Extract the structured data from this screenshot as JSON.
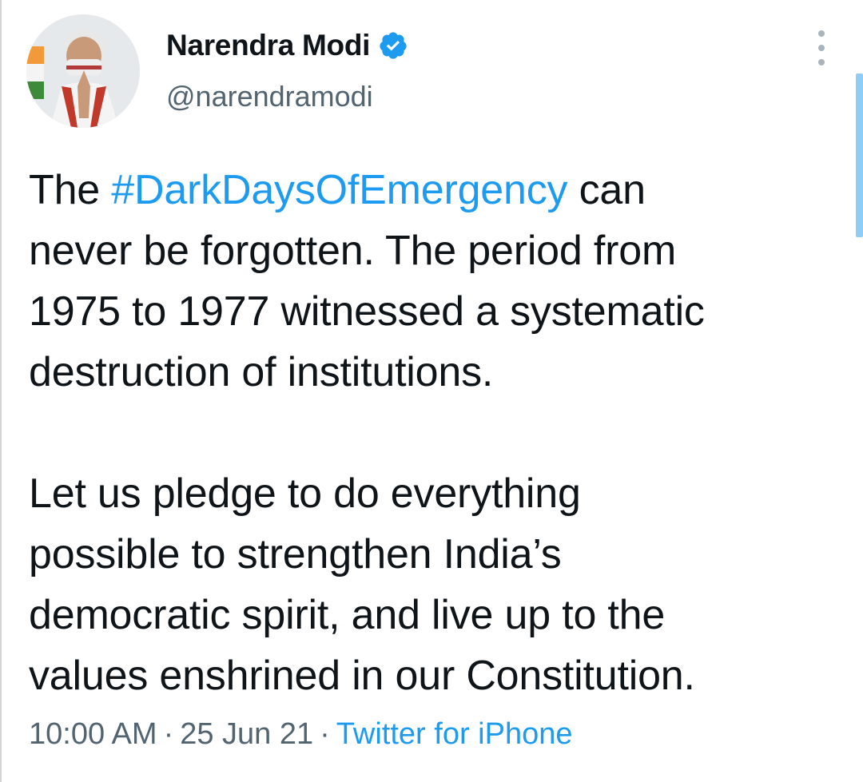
{
  "author": {
    "display_name": "Narendra Modi",
    "handle": "@narendramodi",
    "verified_icon": "verified-badge-icon",
    "avatar": "profile-photo"
  },
  "tweet": {
    "line1_pre": "The ",
    "hashtag": "#DarkDaysOfEmergency",
    "line1_post": " can",
    "line2": "never be forgotten. The period from",
    "line3": "1975 to 1977 witnessed a systematic",
    "line4": "destruction of institutions.",
    "line5": "Let us pledge to do everything",
    "line6": "possible to strengthen India’s",
    "line7": "democratic spirit, and live up to the",
    "line8": "values enshrined in our Constitution."
  },
  "meta": {
    "time": "10:00 AM",
    "date": "25 Jun 21",
    "separator": "·",
    "source": "Twitter for iPhone"
  },
  "colors": {
    "accent": "#1d9bf0",
    "text": "#0f1419",
    "secondary": "#536471"
  },
  "icons": {
    "more": "more-vertical-icon"
  }
}
